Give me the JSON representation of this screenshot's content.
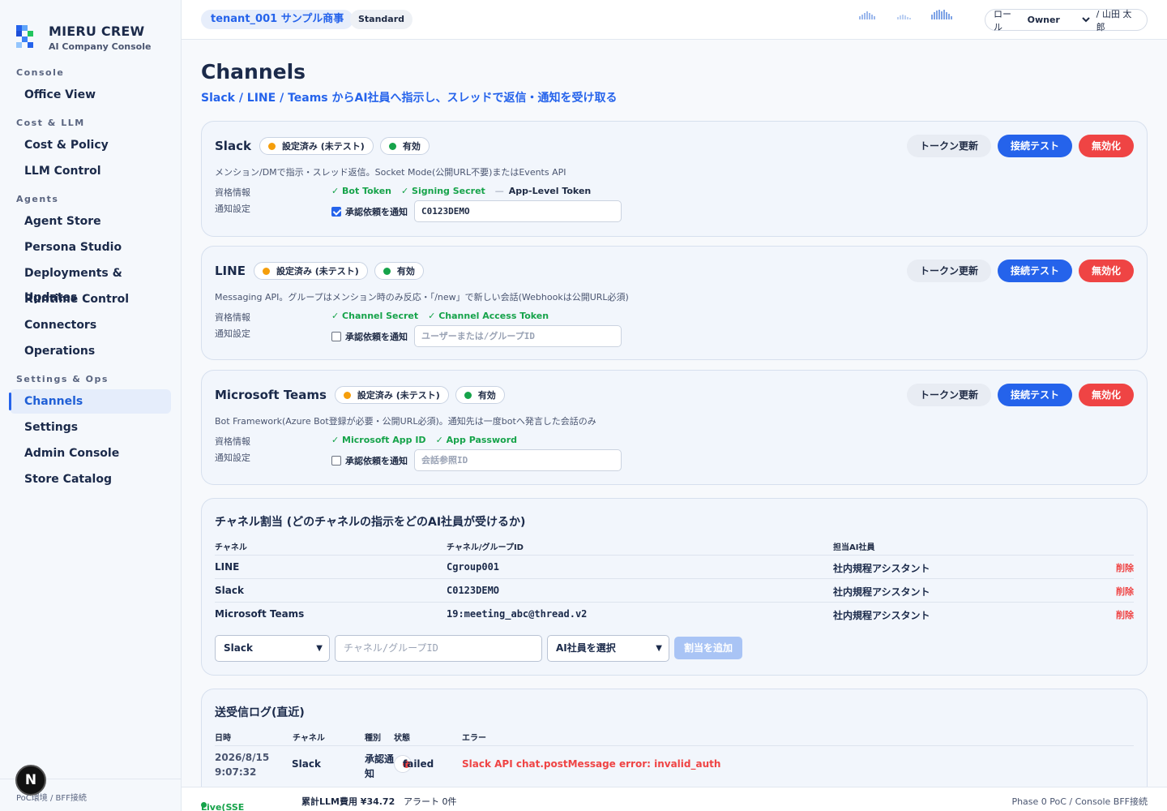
{
  "brand": {
    "name": "MIERU CREW",
    "subtitle": "AI Company Console"
  },
  "sidebar": {
    "sections": [
      {
        "title": "Console",
        "items": [
          {
            "label": "Office View"
          }
        ]
      },
      {
        "title": "Cost & LLM",
        "items": [
          {
            "label": "Cost & Policy"
          },
          {
            "label": "LLM Control"
          }
        ]
      },
      {
        "title": "Agents",
        "items": [
          {
            "label": "Agent Store"
          },
          {
            "label": "Persona Studio"
          },
          {
            "label": "Deployments & Updates"
          },
          {
            "label": "Runtime Control"
          },
          {
            "label": "Connectors"
          },
          {
            "label": "Operations"
          }
        ]
      },
      {
        "title": "Settings & Ops",
        "items": [
          {
            "label": "Channels",
            "active": true
          },
          {
            "label": "Settings"
          },
          {
            "label": "Admin Console"
          },
          {
            "label": "Store Catalog"
          }
        ]
      }
    ],
    "footer": "PoC環境 / BFF接続",
    "badge": "N"
  },
  "header": {
    "tenant": "tenant_001 サンプル商事",
    "plan": "Standard",
    "role_label": "ロール",
    "role_value": "Owner",
    "user": "/ 山田 太郎"
  },
  "page": {
    "title": "Channels",
    "subtitle": "Slack / LINE / Teams からAI社員へ指示し、スレッドで返信・通知を受け取る"
  },
  "common": {
    "creds_label": "資格情報",
    "notify_label": "通知設定",
    "notify_checkbox": "承認依頼を通知",
    "btn_refresh": "トークン更新",
    "btn_test": "接続テスト",
    "btn_disable": "無効化",
    "status_configured": "設定済み (未テスト)",
    "status_enabled": "有効"
  },
  "channels": [
    {
      "name": "Slack",
      "description": "メンション/DMで指示・スレッド返信。Socket Mode(公開URL不要)またはEvents API",
      "creds_ok": [
        "✓ Bot Token",
        "✓ Signing Secret"
      ],
      "creds_missing": "App-Level Token",
      "notify_checked": true,
      "notify_value": "C0123DEMO",
      "notify_placeholder": ""
    },
    {
      "name": "LINE",
      "description": "Messaging API。グループはメンション時のみ反応・「/new」で新しい会話(Webhookは公開URL必須)",
      "creds_ok": [
        "✓ Channel Secret",
        "✓ Channel Access Token"
      ],
      "creds_missing": "",
      "notify_checked": false,
      "notify_value": "",
      "notify_placeholder": "ユーザーまたは/グループID"
    },
    {
      "name": "Microsoft Teams",
      "description": "Bot Framework(Azure Bot登録が必要・公開URL必須)。通知先は一度botへ発言した会話のみ",
      "creds_ok": [
        "✓ Microsoft App ID",
        "✓ App Password"
      ],
      "creds_missing": "",
      "notify_checked": false,
      "notify_value": "",
      "notify_placeholder": "会話参照ID"
    }
  ],
  "assignments": {
    "title": "チャネル割当 (どのチャネルの指示をどのAI社員が受けるか)",
    "headers": [
      "チャネル",
      "チャネル/グループID",
      "担当AI社員"
    ],
    "rows": [
      {
        "channel": "LINE",
        "id": "Cgroup001",
        "agent": "社内規程アシスタント",
        "action": "削除"
      },
      {
        "channel": "Slack",
        "id": "C0123DEMO",
        "agent": "社内規程アシスタント",
        "action": "削除"
      },
      {
        "channel": "Microsoft Teams",
        "id": "19:meeting_abc@thread.v2",
        "agent": "社内規程アシスタント",
        "action": "削除"
      }
    ],
    "form": {
      "channel_selected": "Slack",
      "id_placeholder": "チャネル/グループID",
      "agent_selected": "AI社員を選択",
      "add_button": "割当を追加"
    }
  },
  "log": {
    "title": "送受信ログ(直近)",
    "headers": [
      "日時",
      "チャネル",
      "種別",
      "状態",
      "エラー"
    ],
    "rows": [
      {
        "date": "2026/8/15",
        "time": "9:07:32",
        "channel": "Slack",
        "kind": "承認通知",
        "status": "failed",
        "error": "Slack API chat.postMessage error: invalid_auth"
      }
    ]
  },
  "statusbar": {
    "live": "Live(SSE接続中)",
    "cost": "累計LLM費用 ¥34.72",
    "alerts": "アラート 0件",
    "phase": "Phase 0 PoC / Console BFF接続"
  },
  "colors": {
    "accent": "#2563eb",
    "danger": "#ef4444",
    "success": "#16a34a",
    "warning": "#f59e0b"
  }
}
